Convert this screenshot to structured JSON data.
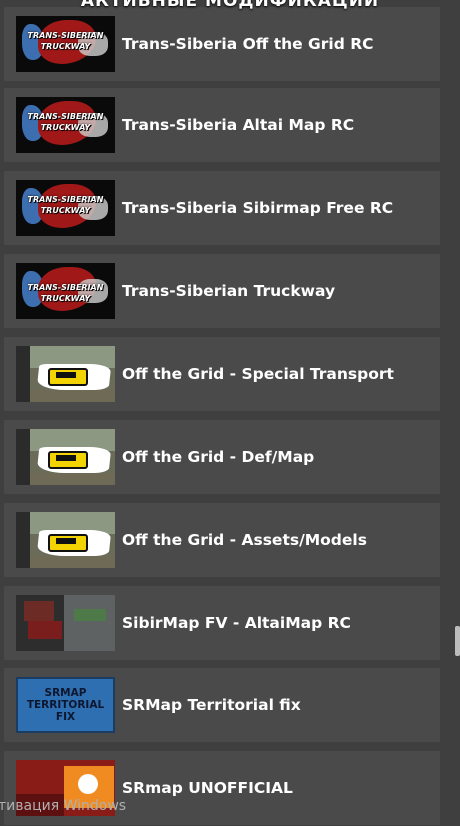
{
  "header": {
    "title": "АКТИВНЫЕ МОДИФИКАЦИИ"
  },
  "mods": [
    {
      "title": "Trans-Siberia Off the Grid RC",
      "thumb": "trans-siberian-truckway-logo",
      "thumb_text": [
        "TRANS-SIBERIAN",
        "TRUCKWAY"
      ]
    },
    {
      "title": "Trans-Siberia Altai Map RC",
      "thumb": "trans-siberian-truckway-logo",
      "thumb_text": [
        "TRANS-SIBERIAN",
        "TRUCKWAY"
      ]
    },
    {
      "title": "Trans-Siberia Sibirmap Free RC",
      "thumb": "trans-siberian-truckway-logo",
      "thumb_text": [
        "TRANS-SIBERIAN",
        "TRUCKWAY"
      ]
    },
    {
      "title": "Trans-Siberian Truckway",
      "thumb": "trans-siberian-truckway-logo",
      "thumb_text": [
        "TRANS-SIBERIAN",
        "TRUCKWAY"
      ]
    },
    {
      "title": "Off the Grid - Special Transport",
      "thumb": "off-the-grid-logo"
    },
    {
      "title": "Off the Grid - Def/Map",
      "thumb": "off-the-grid-logo"
    },
    {
      "title": "Off the Grid - Assets/Models",
      "thumb": "off-the-grid-logo"
    },
    {
      "title": "SibirMap FV - AltaiMap RC",
      "thumb": "sibirmap-collage"
    },
    {
      "title": "SRMap Territorial fix",
      "thumb": "srmap-territorial-fix-logo",
      "thumb_text": [
        "SRMAP",
        "TERRITORIAL",
        "FIX"
      ]
    },
    {
      "title": "SRmap UNOFFICIAL",
      "thumb": "srmap-unofficial-logo"
    }
  ],
  "watermark": "тивация Windows",
  "colors": {
    "background": "#3f3f3f",
    "row": "#4a4a4a",
    "text": "#ffffff"
  }
}
